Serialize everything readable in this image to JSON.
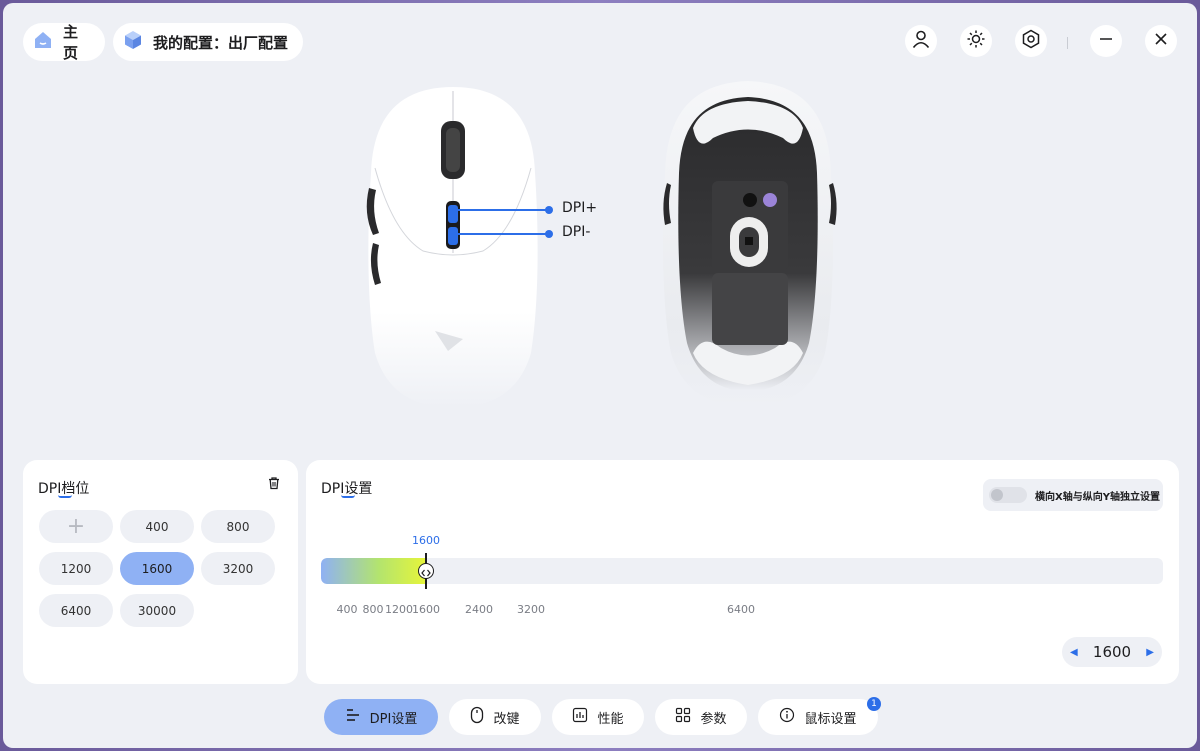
{
  "header": {
    "home_label": "主页",
    "profile_label": "我的配置：出厂配置"
  },
  "mouse_view": {
    "callouts": [
      {
        "label": "DPI+"
      },
      {
        "label": "DPI-"
      }
    ],
    "accent_color": "#2c6ee8"
  },
  "dpi_levels": {
    "title": "DPI档位",
    "add_symbol": "+",
    "chips": [
      {
        "label": "400",
        "active": false
      },
      {
        "label": "800",
        "active": false
      },
      {
        "label": "1200",
        "active": false
      },
      {
        "label": "1600",
        "active": true
      },
      {
        "label": "3200",
        "active": false
      },
      {
        "label": "6400",
        "active": false
      },
      {
        "label": "30000",
        "active": false
      }
    ]
  },
  "dpi_settings": {
    "title": "DPI设置",
    "xy_toggle_label": "横向X轴与纵向Y轴独立设置",
    "xy_toggle_on": false,
    "current_value": "1600",
    "ticks": [
      "400",
      "800",
      "1200",
      "1600",
      "2400",
      "3200",
      "6400"
    ],
    "stepper_value": "1600"
  },
  "bottom_tabs": [
    {
      "label": "DPI设置",
      "icon": "bars-icon",
      "active": true
    },
    {
      "label": "改键",
      "icon": "mouse-icon",
      "active": false
    },
    {
      "label": "性能",
      "icon": "chart-icon",
      "active": false
    },
    {
      "label": "参数",
      "icon": "grid-icon",
      "active": false
    },
    {
      "label": "鼠标设置",
      "icon": "info-icon",
      "active": false
    }
  ],
  "notification_badge": "1"
}
